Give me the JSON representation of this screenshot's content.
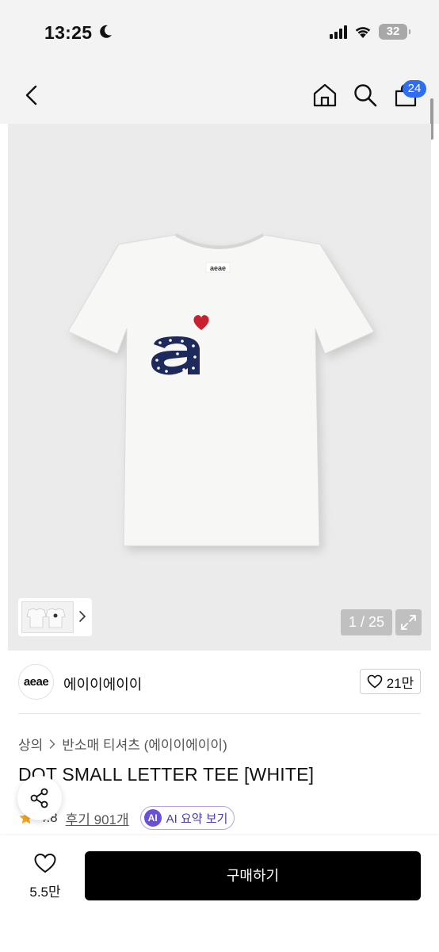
{
  "status_bar": {
    "time": "13:25",
    "battery": "32",
    "icons": [
      "moon-icon",
      "signal-icon",
      "wifi-icon",
      "battery-icon"
    ]
  },
  "nav": {
    "icons": [
      "back-icon",
      "home-icon",
      "search-icon",
      "cart-icon"
    ],
    "cart_badge": "24"
  },
  "gallery": {
    "page_counter": "1 / 25",
    "tag_text": "aeae",
    "icons": [
      "chevron-right-icon",
      "expand-icon"
    ],
    "colors": {
      "background": "#ebebeb",
      "shirt": "#f7f7f5",
      "print_navy": "#1f2a5c",
      "heart": "#c8202e"
    }
  },
  "brand": {
    "logo_text": "aeae",
    "name": "에이이에이이",
    "like_count": "21만"
  },
  "breadcrumb": {
    "items": [
      "상의",
      "반소매 티셔츠 (에이이에이이)"
    ]
  },
  "product": {
    "title": "DOT SMALL LETTER TEE [WHITE]",
    "rating": "4.8",
    "reviews": "후기 901개",
    "ai_badge": "AI",
    "ai_label": "AI 요약 보기"
  },
  "bottom_bar": {
    "wish_count": "5.5만",
    "buy_label": "구매하기",
    "colors": {
      "buy_button": "#000000",
      "accent": "#2f6ef2",
      "ai": "#6a4fd8",
      "star": "#f5a623"
    }
  }
}
